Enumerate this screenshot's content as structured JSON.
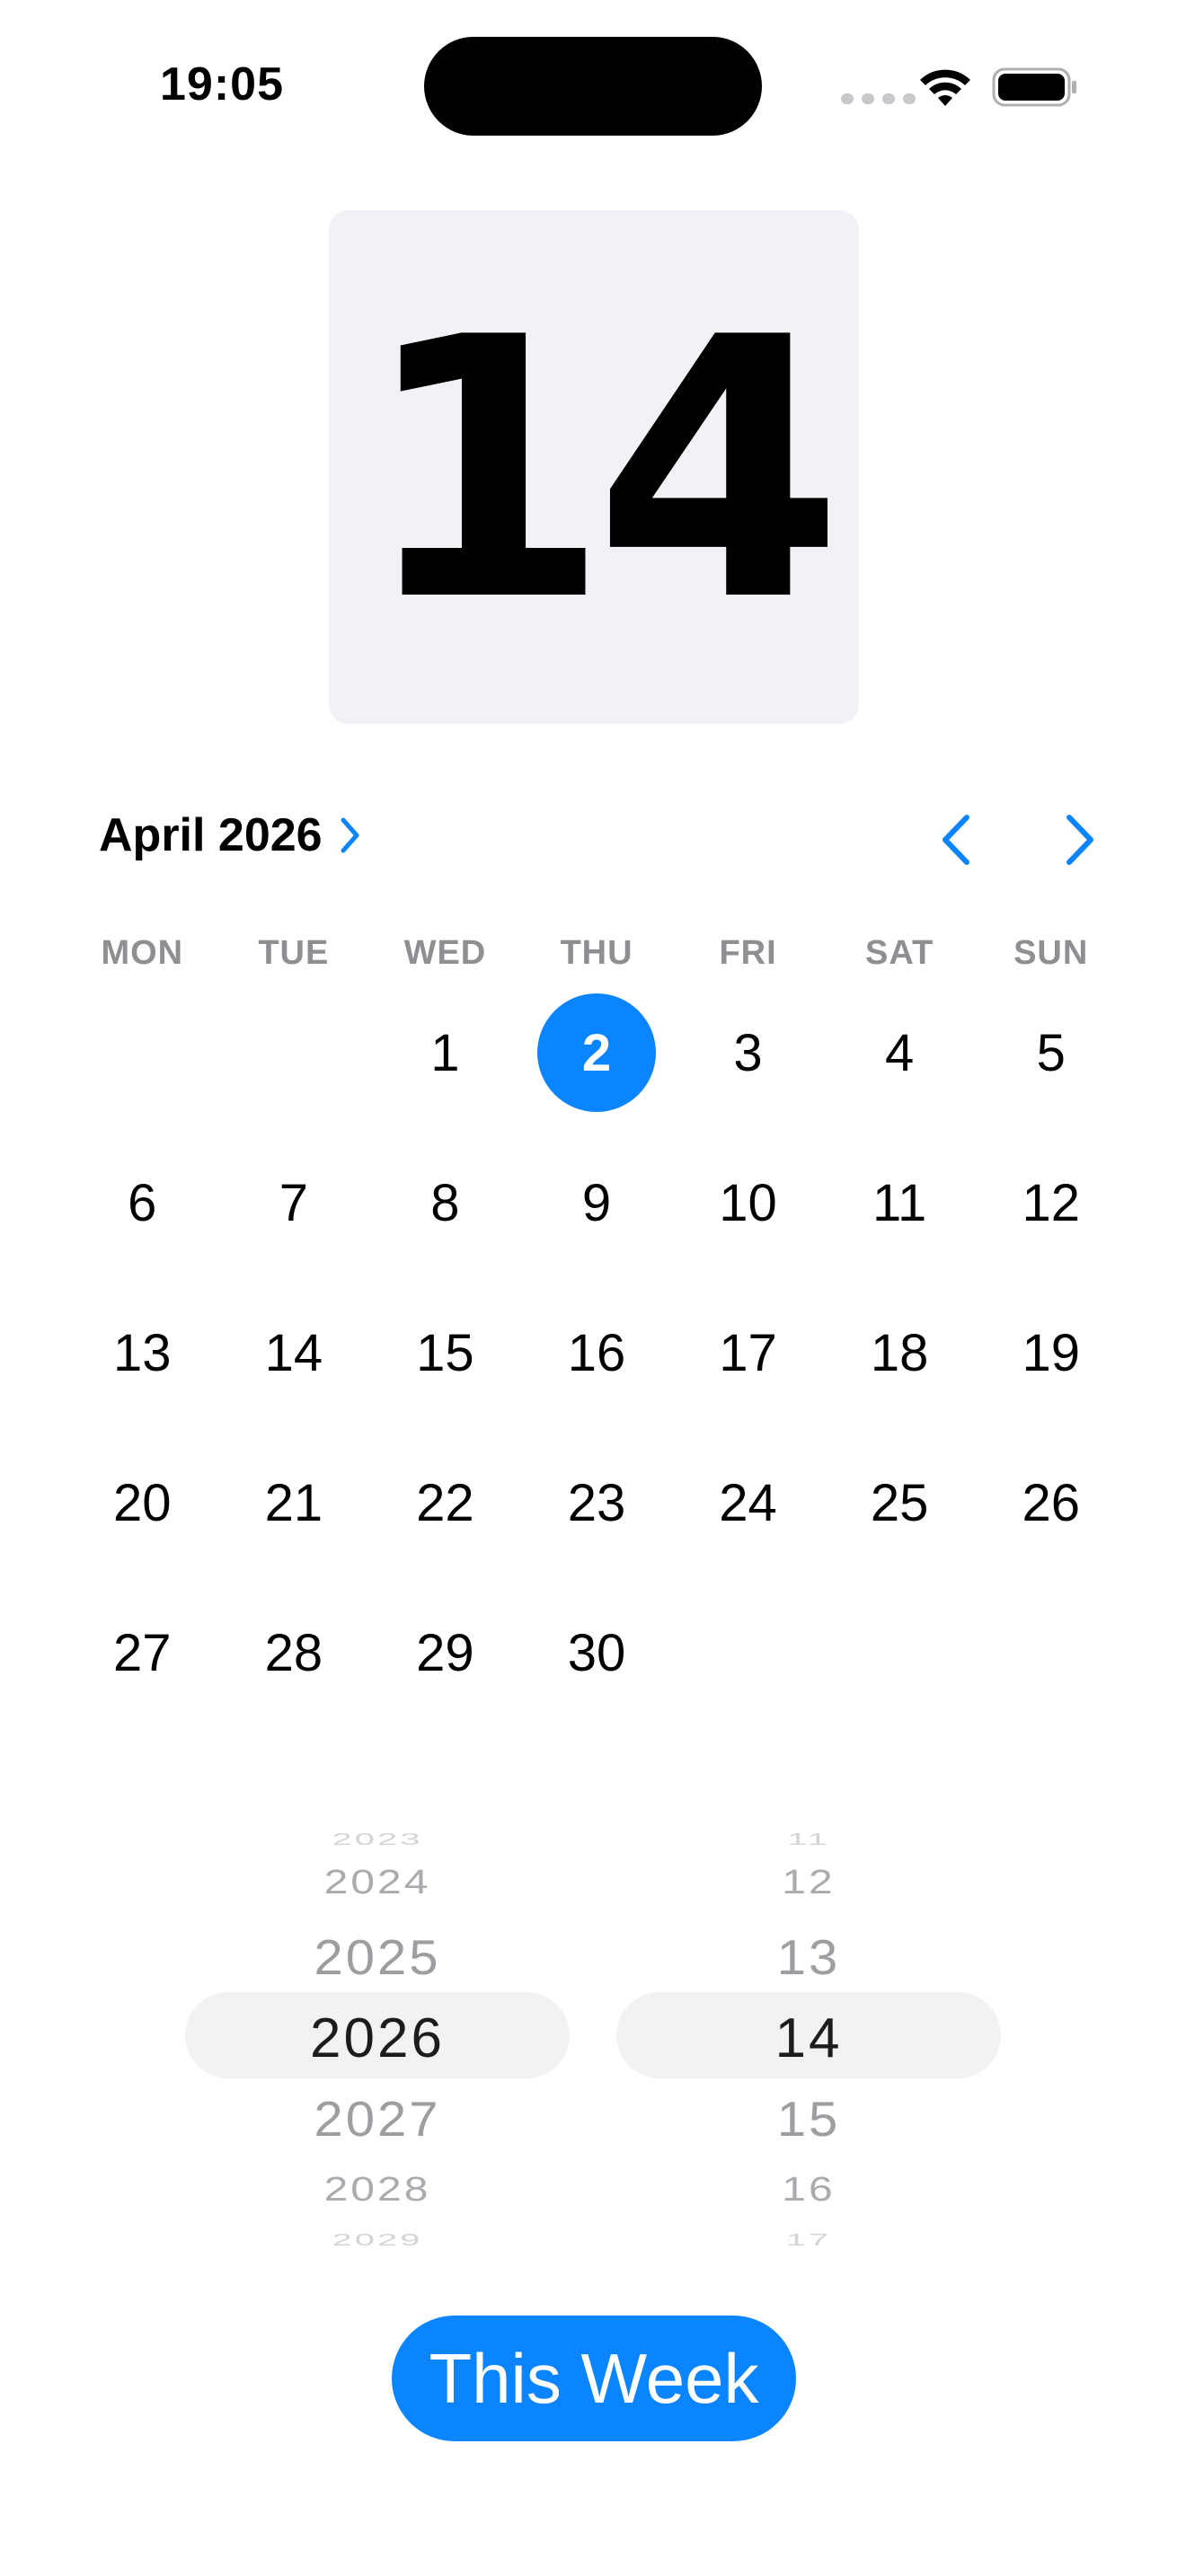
{
  "status_bar": {
    "time": "19:05",
    "wifi_icon": "wifi-icon",
    "battery_icon": "battery-full-icon"
  },
  "hero": {
    "day_number": "14"
  },
  "calendar": {
    "month_label": "April 2026",
    "prev_icon": "chevron-left-icon",
    "next_icon": "chevron-right-icon",
    "accent_color": "#0a84ff",
    "weekdays": [
      "MON",
      "TUE",
      "WED",
      "THU",
      "FRI",
      "SAT",
      "SUN"
    ],
    "leading_blank_days": 2,
    "days": [
      "1",
      "2",
      "3",
      "4",
      "5",
      "6",
      "7",
      "8",
      "9",
      "10",
      "11",
      "12",
      "13",
      "14",
      "15",
      "16",
      "17",
      "18",
      "19",
      "20",
      "21",
      "22",
      "23",
      "24",
      "25",
      "26",
      "27",
      "28",
      "29",
      "30"
    ],
    "selected_day": "2"
  },
  "year_picker": {
    "rows": [
      "2023",
      "2024",
      "2025",
      "2026",
      "2027",
      "2028",
      "2029"
    ],
    "selected": "2026"
  },
  "day_picker": {
    "rows": [
      "11",
      "12",
      "13",
      "14",
      "15",
      "16",
      "17"
    ],
    "selected": "14"
  },
  "this_week_button": {
    "label": "This Week"
  }
}
